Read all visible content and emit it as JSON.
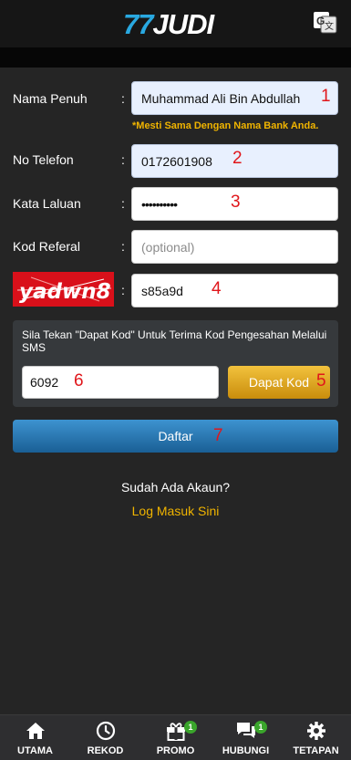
{
  "header": {
    "logo_number": "77",
    "logo_word": "JUDI",
    "translate_icon": "google-translate-icon"
  },
  "form": {
    "full_name": {
      "label": "Nama Penuh",
      "colon": ":",
      "value": "Muhammad Ali Bin Abdullah",
      "marker": "1",
      "hint": "*Mesti Sama Dengan Nama Bank Anda."
    },
    "phone": {
      "label": "No Telefon",
      "colon": ":",
      "value": "0172601908",
      "marker": "2"
    },
    "password": {
      "label": "Kata Laluan",
      "colon": ":",
      "value": "••••••••••",
      "marker": "3"
    },
    "referral": {
      "label": "Kod Referal",
      "colon": ":",
      "placeholder": "(optional)"
    },
    "captcha": {
      "image_text": "yadwn8",
      "colon": ":",
      "value": "s85a9d",
      "marker": "4"
    },
    "sms": {
      "instruction": "Sila Tekan \"Dapat Kod\" Untuk Terima Kod Pengesahan Melalui SMS",
      "code_value": "6092",
      "code_marker": "6",
      "get_code_label": "Dapat Kod",
      "get_code_marker": "5"
    },
    "submit": {
      "label": "Daftar",
      "marker": "7"
    },
    "already_account": "Sudah Ada Akaun?",
    "login_link": "Log Masuk Sini"
  },
  "colors": {
    "accent_gold": "#f0b400",
    "accent_blue": "#29a8e0",
    "marker_red": "#e0161b",
    "badge_green": "#3aa52b"
  },
  "bottom_nav": [
    {
      "label": "UTAMA",
      "icon": "home-icon"
    },
    {
      "label": "REKOD",
      "icon": "clock-icon"
    },
    {
      "label": "PROMO",
      "icon": "gift-icon",
      "badge": "1"
    },
    {
      "label": "HUBUNGI",
      "icon": "chat-icon",
      "badge": "1"
    },
    {
      "label": "TETAPAN",
      "icon": "gear-icon"
    }
  ]
}
